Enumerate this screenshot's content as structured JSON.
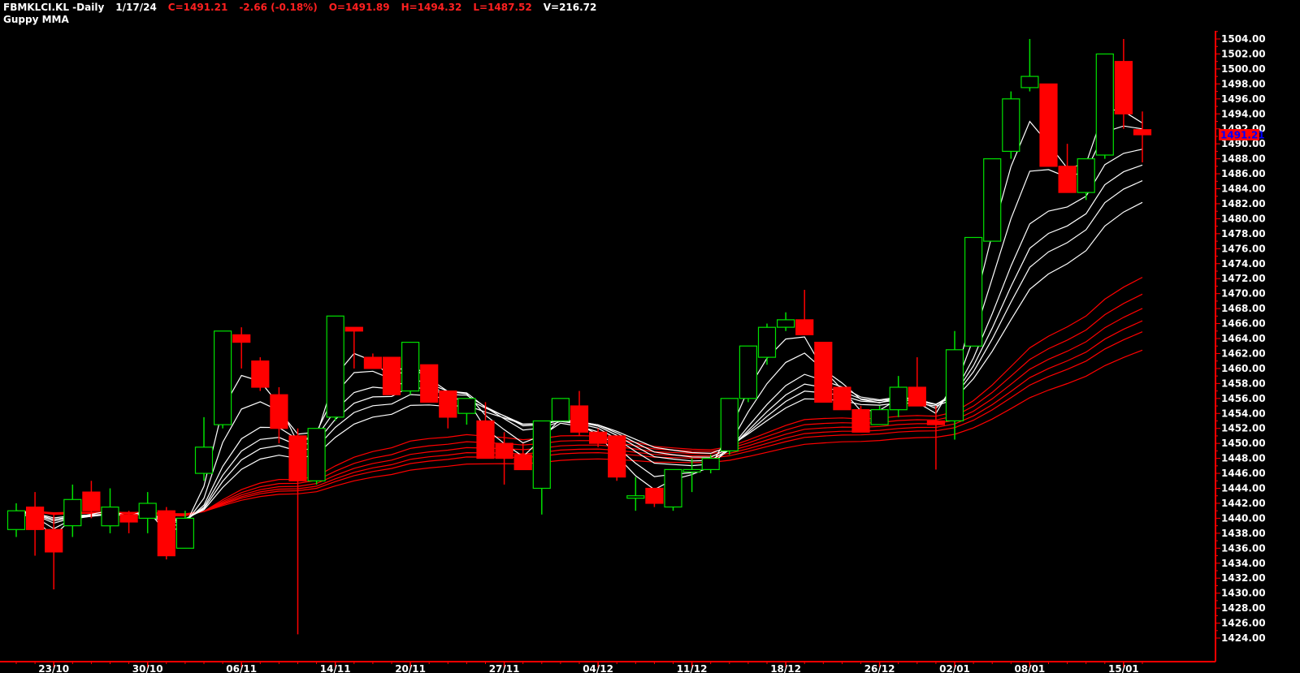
{
  "header": {
    "symbol_period": "FBMKLCI.KL -Daily",
    "date": "1/17/24",
    "close": "C=1491.21",
    "change": "-2.66 (-0.18%)",
    "open": "O=1491.89",
    "high": "H=1494.32",
    "low": "L=1487.52",
    "volume": "V=216.72",
    "indicator": "Guppy MMA"
  },
  "colors": {
    "background": "#000000",
    "bull": "#00e000",
    "bear": "#ff0000",
    "short_ma": "#ffffff",
    "long_ma": "#ff0000",
    "axis": "#ff0000",
    "last_price_bg": "#ff0000",
    "last_price_text": "#0000ff"
  },
  "chart_data": {
    "type": "candlestick",
    "title": "FBMKLCI.KL -Daily",
    "ylim": [
      1424,
      1504
    ],
    "y_ticks": [
      1424,
      1426,
      1428,
      1430,
      1432,
      1434,
      1436,
      1438,
      1440,
      1442,
      1444,
      1446,
      1448,
      1450,
      1452,
      1454,
      1456,
      1458,
      1460,
      1462,
      1464,
      1466,
      1468,
      1470,
      1472,
      1474,
      1476,
      1478,
      1480,
      1482,
      1484,
      1486,
      1488,
      1490,
      1492,
      1494,
      1496,
      1498,
      1500,
      1502,
      1504
    ],
    "y_tick_labels": [
      "1424.00",
      "1426.00",
      "1428.00",
      "1430.00",
      "1432.00",
      "1434.00",
      "1436.00",
      "1438.00",
      "1440.00",
      "1442.00",
      "1444.00",
      "1446.00",
      "1448.00",
      "1450.00",
      "1452.00",
      "1454.00",
      "1456.00",
      "1458.00",
      "1460.00",
      "1462.00",
      "1464.00",
      "1466.00",
      "1468.00",
      "1470.00",
      "1472.00",
      "1474.00",
      "1476.00",
      "1478.00",
      "1480.00",
      "1482.00",
      "1484.00",
      "1486.00",
      "1488.00",
      "1490.00",
      "1492.00",
      "1494.00",
      "1496.00",
      "1498.00",
      "1500.00",
      "1502.00",
      "1504.00"
    ],
    "last_price": "1491.21",
    "x_tick_labels": [
      {
        "index": 2,
        "label": "23/10"
      },
      {
        "index": 7,
        "label": "30/10"
      },
      {
        "index": 12,
        "label": "06/11"
      },
      {
        "index": 17,
        "label": "14/11"
      },
      {
        "index": 21,
        "label": "20/11"
      },
      {
        "index": 26,
        "label": "27/11"
      },
      {
        "index": 31,
        "label": "04/12"
      },
      {
        "index": 36,
        "label": "11/12"
      },
      {
        "index": 41,
        "label": "18/12"
      },
      {
        "index": 46,
        "label": "26/12"
      },
      {
        "index": 50,
        "label": "02/01"
      },
      {
        "index": 54,
        "label": "08/01"
      },
      {
        "index": 59,
        "label": "15/01"
      }
    ],
    "candles": [
      {
        "o": 1438.5,
        "h": 1442,
        "l": 1437.5,
        "c": 1441
      },
      {
        "o": 1441.5,
        "h": 1443.5,
        "l": 1435,
        "c": 1438.5
      },
      {
        "o": 1438.5,
        "h": 1440.5,
        "l": 1430.5,
        "c": 1435.5
      },
      {
        "o": 1439,
        "h": 1444.5,
        "l": 1437.5,
        "c": 1442.5
      },
      {
        "o": 1443.5,
        "h": 1445,
        "l": 1440,
        "c": 1441
      },
      {
        "o": 1439,
        "h": 1444,
        "l": 1438,
        "c": 1441.5
      },
      {
        "o": 1440.5,
        "h": 1441,
        "l": 1438,
        "c": 1439.5
      },
      {
        "o": 1440,
        "h": 1443.5,
        "l": 1438,
        "c": 1442
      },
      {
        "o": 1441,
        "h": 1441.5,
        "l": 1434.5,
        "c": 1435
      },
      {
        "o": 1436,
        "h": 1441,
        "l": 1436,
        "c": 1440
      },
      {
        "o": 1446,
        "h": 1453.5,
        "l": 1445,
        "c": 1449.5
      },
      {
        "o": 1452.5,
        "h": 1465,
        "l": 1452,
        "c": 1465
      },
      {
        "o": 1464.5,
        "h": 1465.5,
        "l": 1460,
        "c": 1463.5
      },
      {
        "o": 1461,
        "h": 1461.5,
        "l": 1457,
        "c": 1457.5
      },
      {
        "o": 1456.5,
        "h": 1457.5,
        "l": 1450,
        "c": 1452
      },
      {
        "o": 1451,
        "h": 1452,
        "l": 1424.5,
        "c": 1445
      },
      {
        "o": 1445,
        "h": 1452,
        "l": 1444.5,
        "c": 1452
      },
      {
        "o": 1453.5,
        "h": 1467,
        "l": 1453,
        "c": 1467
      },
      {
        "o": 1465.5,
        "h": 1465.5,
        "l": 1460,
        "c": 1465
      },
      {
        "o": 1461.5,
        "h": 1462,
        "l": 1460,
        "c": 1460
      },
      {
        "o": 1461.5,
        "h": 1461.5,
        "l": 1456.5,
        "c": 1456.5
      },
      {
        "o": 1457,
        "h": 1463.5,
        "l": 1456.5,
        "c": 1463.5
      },
      {
        "o": 1460.5,
        "h": 1460.5,
        "l": 1455.5,
        "c": 1455.5
      },
      {
        "o": 1457,
        "h": 1457,
        "l": 1452,
        "c": 1453.5
      },
      {
        "o": 1454,
        "h": 1456,
        "l": 1452.5,
        "c": 1456
      },
      {
        "o": 1453,
        "h": 1455.5,
        "l": 1448,
        "c": 1448
      },
      {
        "o": 1450,
        "h": 1451.5,
        "l": 1444.5,
        "c": 1448
      },
      {
        "o": 1448.5,
        "h": 1450,
        "l": 1446.5,
        "c": 1446.5
      },
      {
        "o": 1444,
        "h": 1453,
        "l": 1440.5,
        "c": 1453
      },
      {
        "o": 1453,
        "h": 1456,
        "l": 1453,
        "c": 1456
      },
      {
        "o": 1455,
        "h": 1457,
        "l": 1451,
        "c": 1451.5
      },
      {
        "o": 1451.5,
        "h": 1452,
        "l": 1449.5,
        "c": 1450
      },
      {
        "o": 1451,
        "h": 1451,
        "l": 1445,
        "c": 1445.5
      },
      {
        "o": 1443,
        "h": 1445.5,
        "l": 1441,
        "c": 1443
      },
      {
        "o": 1444,
        "h": 1444,
        "l": 1441.5,
        "c": 1442
      },
      {
        "o": 1441.5,
        "h": 1446.5,
        "l": 1441,
        "c": 1446.5
      },
      {
        "o": 1446.5,
        "h": 1448,
        "l": 1443.5,
        "c": 1446.5
      },
      {
        "o": 1446.5,
        "h": 1448.5,
        "l": 1446,
        "c": 1448
      },
      {
        "o": 1449,
        "h": 1456,
        "l": 1448.5,
        "c": 1456
      },
      {
        "o": 1456,
        "h": 1463,
        "l": 1455.5,
        "c": 1463
      },
      {
        "o": 1461.5,
        "h": 1466,
        "l": 1460.5,
        "c": 1465.5
      },
      {
        "o": 1465.5,
        "h": 1467.5,
        "l": 1465,
        "c": 1466.5
      },
      {
        "o": 1466.5,
        "h": 1470.5,
        "l": 1464.5,
        "c": 1464.5
      },
      {
        "o": 1463.5,
        "h": 1463.5,
        "l": 1455.5,
        "c": 1455.5
      },
      {
        "o": 1457.5,
        "h": 1457.5,
        "l": 1454.5,
        "c": 1454.5
      },
      {
        "o": 1454.5,
        "h": 1455,
        "l": 1451.5,
        "c": 1451.5
      },
      {
        "o": 1452.5,
        "h": 1455,
        "l": 1452.5,
        "c": 1454.5
      },
      {
        "o": 1454.5,
        "h": 1459,
        "l": 1453.5,
        "c": 1457.5
      },
      {
        "o": 1457.5,
        "h": 1461.5,
        "l": 1455,
        "c": 1455
      },
      {
        "o": 1453,
        "h": 1455,
        "l": 1446.5,
        "c": 1452.5
      },
      {
        "o": 1453,
        "h": 1465,
        "l": 1450.5,
        "c": 1462.5
      },
      {
        "o": 1463,
        "h": 1477.5,
        "l": 1463,
        "c": 1477.5
      },
      {
        "o": 1477,
        "h": 1488,
        "l": 1477,
        "c": 1488
      },
      {
        "o": 1489,
        "h": 1497,
        "l": 1488,
        "c": 1496
      },
      {
        "o": 1497.5,
        "h": 1504,
        "l": 1497,
        "c": 1499
      },
      {
        "o": 1498,
        "h": 1498,
        "l": 1487,
        "c": 1487
      },
      {
        "o": 1487,
        "h": 1490,
        "l": 1483.5,
        "c": 1483.5
      },
      {
        "o": 1483.5,
        "h": 1488,
        "l": 1482.5,
        "c": 1488
      },
      {
        "o": 1488.5,
        "h": 1502,
        "l": 1488,
        "c": 1502
      },
      {
        "o": 1501,
        "h": 1504,
        "l": 1492,
        "c": 1494
      },
      {
        "o": 1491.89,
        "h": 1494.32,
        "l": 1487.52,
        "c": 1491.21
      }
    ]
  }
}
